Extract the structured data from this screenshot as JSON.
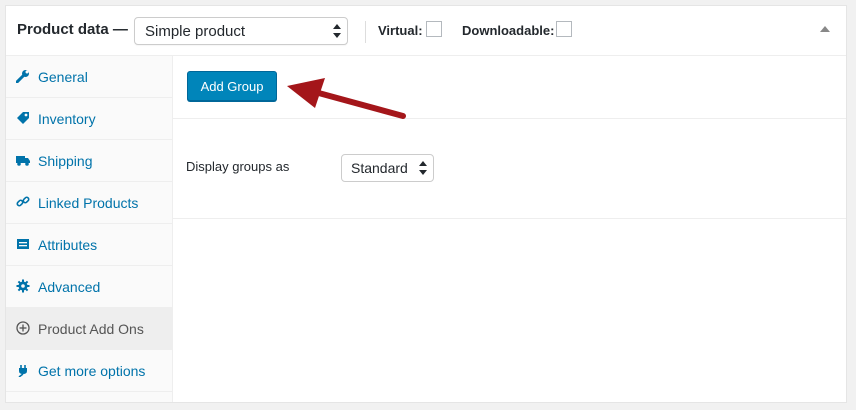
{
  "header": {
    "title": "Product data —",
    "product_type": "Simple product",
    "virtual_label": "Virtual:",
    "downloadable_label": "Downloadable:"
  },
  "sidebar": {
    "items": [
      {
        "label": "General",
        "icon": "wrench-icon"
      },
      {
        "label": "Inventory",
        "icon": "tag-icon"
      },
      {
        "label": "Shipping",
        "icon": "truck-icon"
      },
      {
        "label": "Linked Products",
        "icon": "link-icon"
      },
      {
        "label": "Attributes",
        "icon": "list-icon"
      },
      {
        "label": "Advanced",
        "icon": "gear-icon"
      },
      {
        "label": "Product Add Ons",
        "icon": "plus-circle-icon"
      },
      {
        "label": "Get more options",
        "icon": "plug-icon"
      }
    ],
    "active_index": 6
  },
  "main": {
    "add_group_label": "Add Group",
    "display_groups_label": "Display groups as",
    "display_groups_value": "Standard"
  },
  "colors": {
    "link": "#0073aa",
    "primary_button": "#0085ba",
    "annotation_arrow": "#a4161a"
  }
}
